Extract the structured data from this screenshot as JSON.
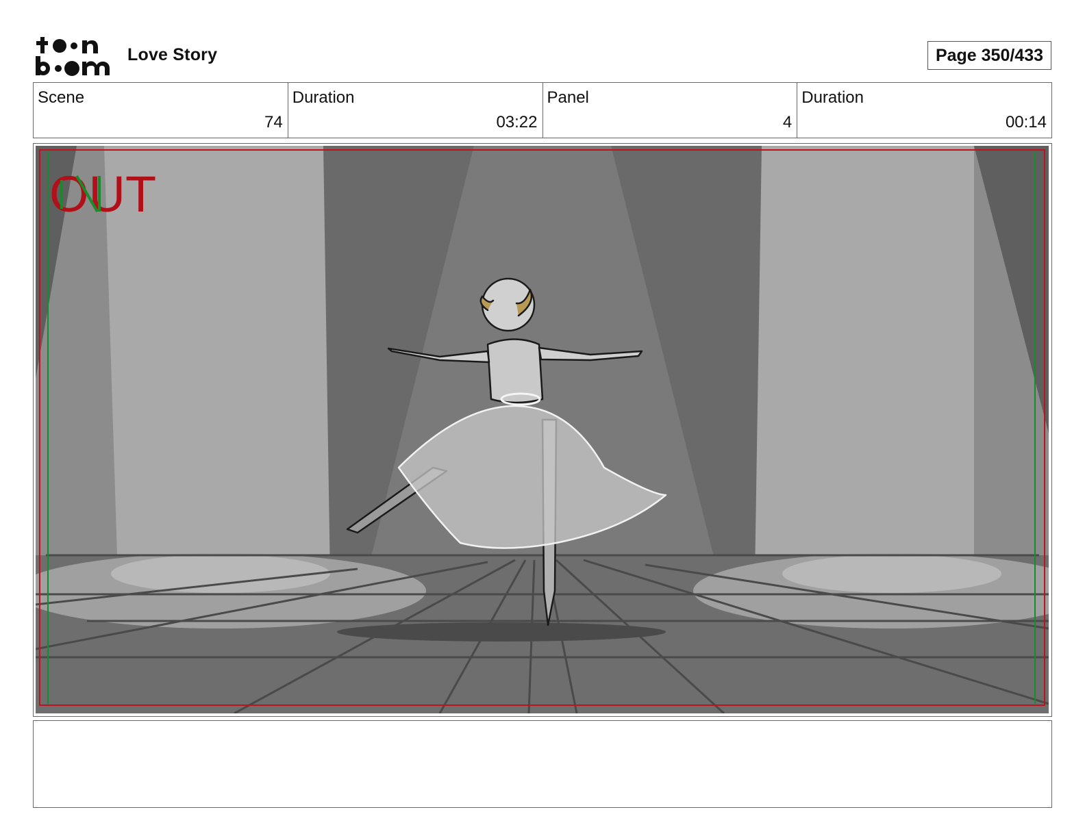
{
  "header": {
    "logo_text": "toon boom",
    "title": "Love Story",
    "page_label": "Page 350/433"
  },
  "info": {
    "scene_label": "Scene",
    "scene_value": "74",
    "scene_duration_label": "Duration",
    "scene_duration_value": "03:22",
    "panel_label": "Panel",
    "panel_value": "4",
    "panel_duration_label": "Duration",
    "panel_duration_value": "00:14"
  },
  "panel": {
    "overlay_text": "OUT",
    "safe_frame_colors": {
      "outer": "#c0121c",
      "inner": "#1a8a2a"
    }
  },
  "notes": {
    "text": ""
  }
}
